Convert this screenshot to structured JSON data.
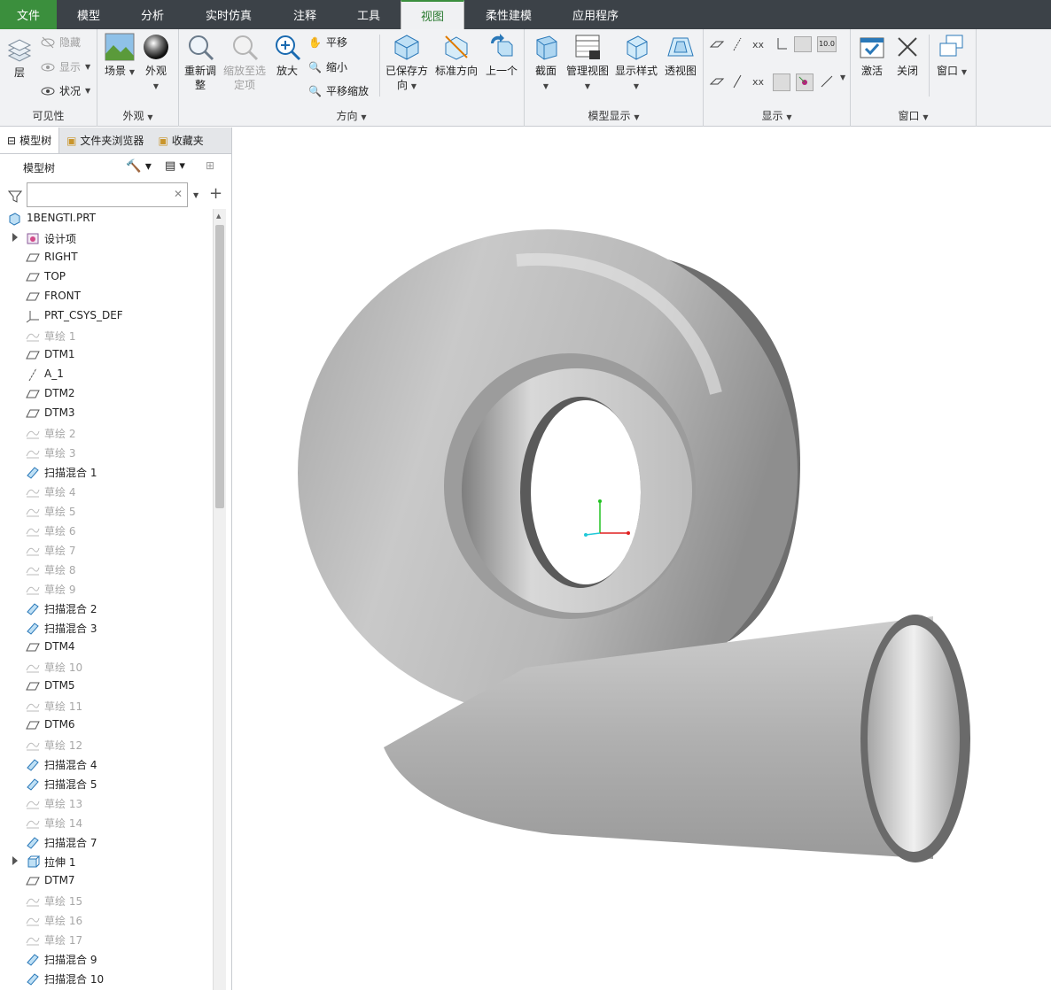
{
  "tabs": [
    "文件",
    "模型",
    "分析",
    "实时仿真",
    "注释",
    "工具",
    "视图",
    "柔性建模",
    "应用程序"
  ],
  "active_tab": "视图",
  "ribbon": {
    "visibility": {
      "layer": "层",
      "hide": "隐藏",
      "show": "显示",
      "status": "状况",
      "label": "可见性"
    },
    "appearance": {
      "scene": "场景",
      "look": "外观",
      "label": "外观"
    },
    "orientation": {
      "refit": "重新调整",
      "zoom_sel": "缩放至选定项",
      "zoom_in": "放大",
      "pan": "平移",
      "zoom_out": "缩小",
      "pan_zoom": "平移缩放",
      "saved": "已保存方向",
      "standard": "标准方向",
      "previous": "上一个",
      "label": "方向"
    },
    "model_display": {
      "section": "截面",
      "manage": "管理视图",
      "style": "显示样式",
      "perspective": "透视图",
      "label": "模型显示"
    },
    "show": {
      "label": "显示"
    },
    "window": {
      "activate": "激活",
      "close": "关闭",
      "window": "窗口",
      "label": "窗口"
    }
  },
  "panel": {
    "tabs": [
      "模型树",
      "文件夹浏览器",
      "收藏夹"
    ],
    "title": "模型树",
    "search_placeholder": ""
  },
  "tree": [
    {
      "label": "1BENGTI.PRT",
      "icon": "part-icon",
      "root": true
    },
    {
      "label": "设计项",
      "icon": "design-items-icon",
      "exp": true
    },
    {
      "label": "RIGHT",
      "icon": "datum-plane-icon"
    },
    {
      "label": "TOP",
      "icon": "datum-plane-icon"
    },
    {
      "label": "FRONT",
      "icon": "datum-plane-icon"
    },
    {
      "label": "PRT_CSYS_DEF",
      "icon": "csys-icon"
    },
    {
      "label": "草绘 1",
      "icon": "sketch-icon",
      "dim": true
    },
    {
      "label": "DTM1",
      "icon": "datum-plane-icon"
    },
    {
      "label": "A_1",
      "icon": "axis-icon"
    },
    {
      "label": "DTM2",
      "icon": "datum-plane-icon"
    },
    {
      "label": "DTM3",
      "icon": "datum-plane-icon"
    },
    {
      "label": "草绘 2",
      "icon": "sketch-icon",
      "dim": true
    },
    {
      "label": "草绘 3",
      "icon": "sketch-icon",
      "dim": true
    },
    {
      "label": "扫描混合 1",
      "icon": "sweep-blend-icon"
    },
    {
      "label": "草绘 4",
      "icon": "sketch-icon",
      "dim": true
    },
    {
      "label": "草绘 5",
      "icon": "sketch-icon",
      "dim": true
    },
    {
      "label": "草绘 6",
      "icon": "sketch-icon",
      "dim": true
    },
    {
      "label": "草绘 7",
      "icon": "sketch-icon",
      "dim": true
    },
    {
      "label": "草绘 8",
      "icon": "sketch-icon",
      "dim": true
    },
    {
      "label": "草绘 9",
      "icon": "sketch-icon",
      "dim": true
    },
    {
      "label": "扫描混合 2",
      "icon": "sweep-blend-icon"
    },
    {
      "label": "扫描混合 3",
      "icon": "sweep-blend-icon"
    },
    {
      "label": "DTM4",
      "icon": "datum-plane-icon"
    },
    {
      "label": "草绘 10",
      "icon": "sketch-icon",
      "dim": true
    },
    {
      "label": "DTM5",
      "icon": "datum-plane-icon"
    },
    {
      "label": "草绘 11",
      "icon": "sketch-icon",
      "dim": true
    },
    {
      "label": "DTM6",
      "icon": "datum-plane-icon"
    },
    {
      "label": "草绘 12",
      "icon": "sketch-icon",
      "dim": true
    },
    {
      "label": "扫描混合 4",
      "icon": "sweep-blend-icon"
    },
    {
      "label": "扫描混合 5",
      "icon": "sweep-blend-icon"
    },
    {
      "label": "草绘 13",
      "icon": "sketch-icon",
      "dim": true
    },
    {
      "label": "草绘 14",
      "icon": "sketch-icon",
      "dim": true
    },
    {
      "label": "扫描混合 7",
      "icon": "sweep-blend-icon"
    },
    {
      "label": "拉伸 1",
      "icon": "extrude-icon",
      "exp": true
    },
    {
      "label": "DTM7",
      "icon": "datum-plane-icon"
    },
    {
      "label": "草绘 15",
      "icon": "sketch-icon",
      "dim": true
    },
    {
      "label": "草绘 16",
      "icon": "sketch-icon",
      "dim": true
    },
    {
      "label": "草绘 17",
      "icon": "sketch-icon",
      "dim": true
    },
    {
      "label": "扫描混合 9",
      "icon": "sweep-blend-icon"
    },
    {
      "label": "扫描混合 10",
      "icon": "sweep-blend-icon"
    }
  ],
  "colors": {
    "accent": "#3b8f3d",
    "tabbar": "#3c4248",
    "model": "#b8b8b8"
  }
}
